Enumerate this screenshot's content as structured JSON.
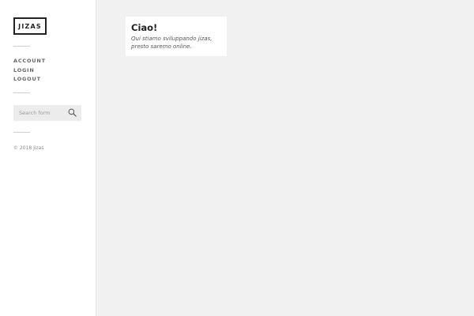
{
  "sidebar": {
    "logo_text": "JIZAS",
    "nav_items": [
      {
        "label": "ACCOUNT"
      },
      {
        "label": "LOGIN"
      },
      {
        "label": "LOGOUT"
      }
    ],
    "search": {
      "placeholder": "Search form",
      "value": "",
      "icon": "search-icon"
    },
    "copyright": "© 2018 Jizas"
  },
  "main": {
    "card": {
      "title": "Ciao!",
      "line1": "Qui stiamo sviluppando jizas,",
      "line2": "presto saremo online."
    }
  },
  "colors": {
    "sidebar_bg": "#ffffff",
    "page_bg": "#f1f1f1",
    "search_bg": "#ececec",
    "text_dark": "#222222"
  }
}
